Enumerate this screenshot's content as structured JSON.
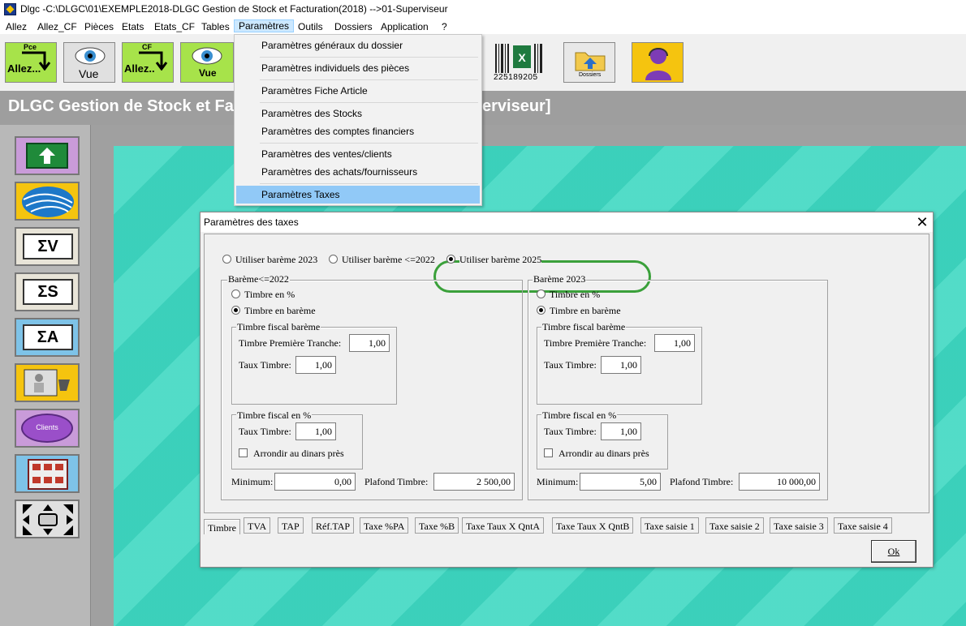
{
  "window": {
    "title": "Dlgc -C:\\DLGC\\01\\EXEMPLE2018-DLGC Gestion de Stock et Facturation(2018) -->01-Superviseur",
    "icon": "app-logo-icon"
  },
  "menubar": [
    "Allez",
    "Allez_CF",
    "Pièces",
    "Etats",
    "Etats_CF",
    "Tables",
    "Paramètres",
    "Outils",
    "Dossiers",
    "Application",
    "?"
  ],
  "toolbar": {
    "pce_small": "Pce",
    "pce_label": "Allez...",
    "vue_label": "Vue",
    "cf_small": "CF",
    "cf_label": "Allez..",
    "vue2_label": "Vue",
    "barcode_digits": "225189205",
    "folder_label": "Dossiers"
  },
  "banner": {
    "text": "DLGC Gestion de Stock et Fa",
    "text_tail": "erviseur]"
  },
  "sidebar": {
    "clients_label": "Clients",
    "sigma_v": "ΣV",
    "sigma_s": "ΣS",
    "sigma_a": "ΣA"
  },
  "dropdown": [
    "Paramètres généraux du dossier",
    "Paramètres individuels des pièces",
    "Paramètres Fiche Article",
    "Paramètres des Stocks",
    "Paramètres des comptes financiers",
    "Paramètres des ventes/clients",
    "Paramètres des achats/fournisseurs",
    "Paramètres Taxes"
  ],
  "dialog": {
    "title": "Paramètres des taxes",
    "radio_2023": "Utiliser barème 2023",
    "radio_2022": "Utiliser barème <=2022",
    "radio_2025": "Utiliser barème 2025",
    "left": {
      "title": "Barème<=2022",
      "timbre_pct": "Timbre en %",
      "timbre_bareme": "Timbre en barème",
      "fiscal_bareme_title": "Timbre fiscal barème",
      "premiere_tranche_label": "Timbre Première Tranche:",
      "premiere_tranche_value": "1,00",
      "taux_timbre_label": "Taux Timbre:",
      "taux_timbre_value": "1,00",
      "fiscal_pct_title": "Timbre fiscal en %",
      "taux_timbre2_label": "Taux Timbre:",
      "taux_timbre2_value": "1,00",
      "arrondir_label": "Arrondir au dinars près",
      "minimum_label": "Minimum:",
      "minimum_value": "0,00",
      "plafond_label": "Plafond Timbre:",
      "plafond_value": "2 500,00"
    },
    "right": {
      "title": "Barème 2023",
      "timbre_pct": "Timbre en %",
      "timbre_bareme": "Timbre en barème",
      "fiscal_bareme_title": "Timbre fiscal barème",
      "premiere_tranche_label": "Timbre Première Tranche:",
      "premiere_tranche_value": "1,00",
      "taux_timbre_label": "Taux Timbre:",
      "taux_timbre_value": "1,00",
      "fiscal_pct_title": "Timbre fiscal en %",
      "taux_timbre2_label": "Taux Timbre:",
      "taux_timbre2_value": "1,00",
      "arrondir_label": "Arrondir au dinars près",
      "minimum_label": "Minimum:",
      "minimum_value": "5,00",
      "plafond_label": "Plafond Timbre:",
      "plafond_value": "10 000,00"
    },
    "tabs": [
      "Timbre",
      "TVA",
      "TAP",
      "Réf.TAP",
      "Taxe %PA",
      "Taxe %B",
      "Taxe Taux X QntA",
      "Taxe Taux X QntB",
      "Taxe saisie 1",
      "Taxe saisie 2",
      "Taxe saisie 3",
      "Taxe saisie 4"
    ],
    "ok_label": "Ok"
  },
  "colors": {
    "accent_highlight": "#91c9f7",
    "annotation_oval": "#3aa03a",
    "desktop_teal": "#3fd8c2",
    "banner_grey": "#9e9e9e"
  }
}
